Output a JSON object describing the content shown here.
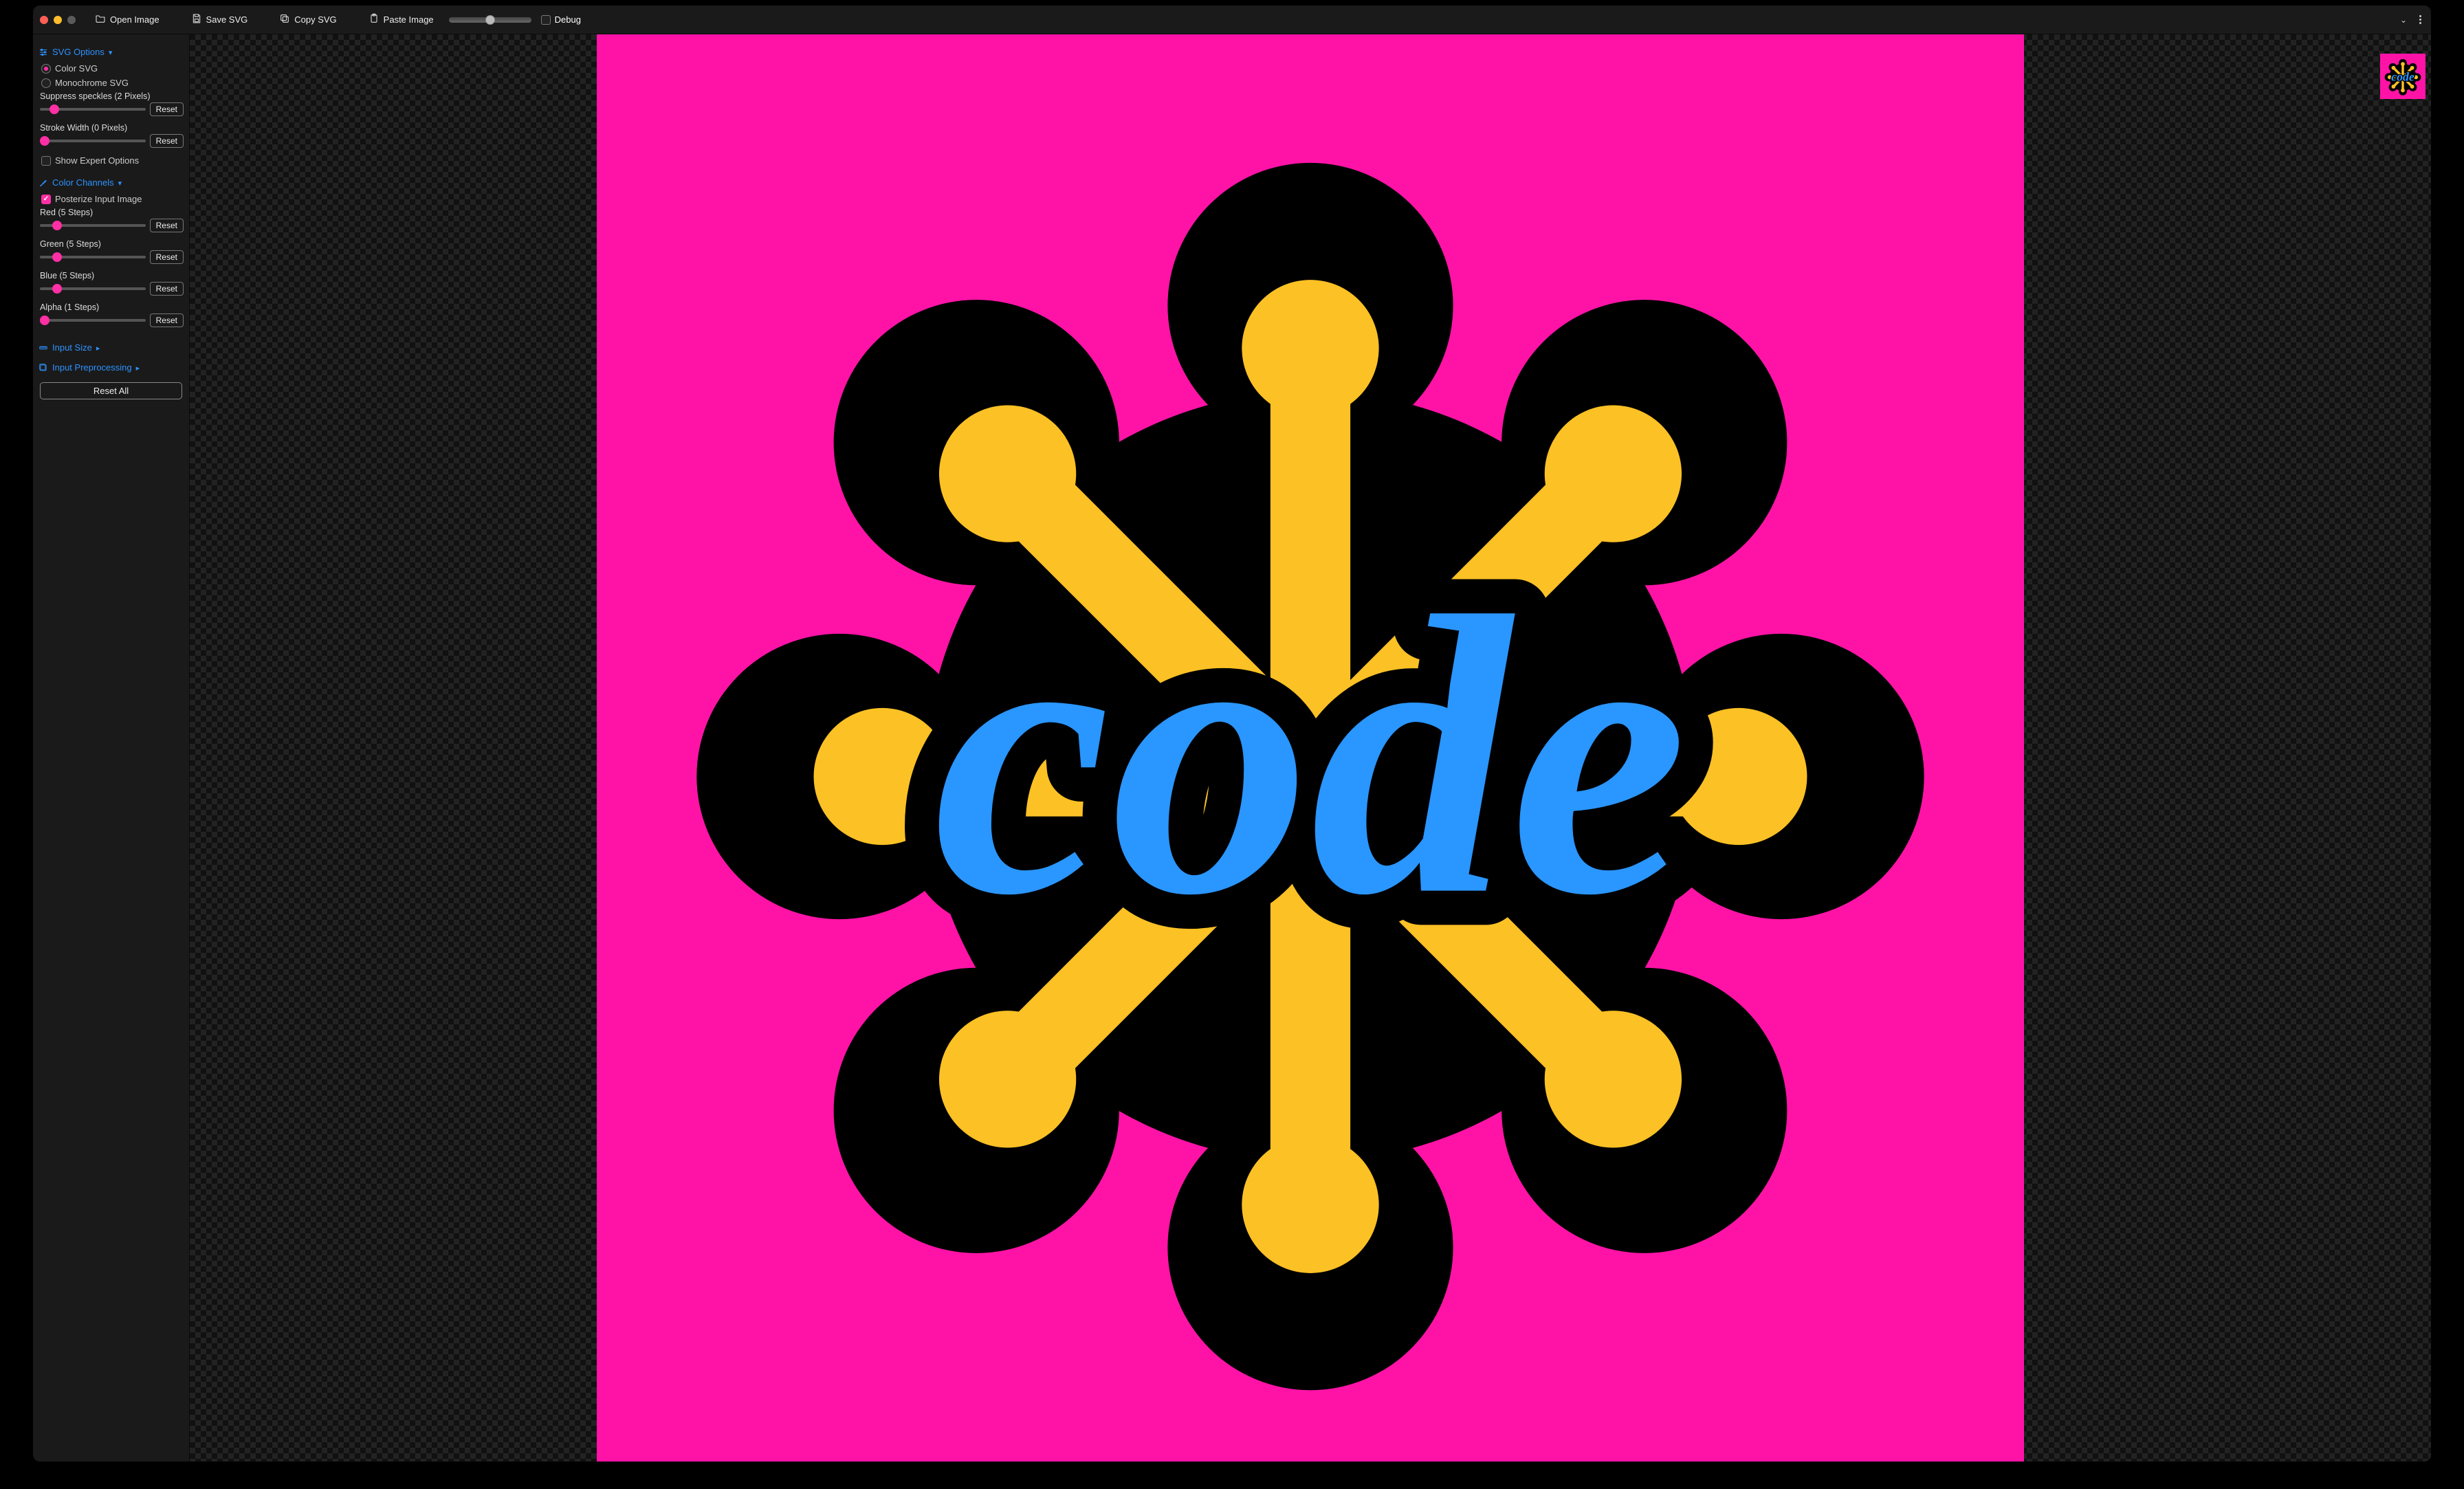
{
  "toolbar": {
    "open_label": "Open Image",
    "save_label": "Save SVG",
    "copy_label": "Copy SVG",
    "paste_label": "Paste Image",
    "debug_label": "Debug"
  },
  "sidebar": {
    "svg_options": {
      "title": "SVG Options",
      "color_svg_label": "Color SVG",
      "mono_svg_label": "Monochrome SVG",
      "speckles_label": "Suppress speckles (2 Pixels)",
      "speckles_value": 2,
      "speckles_max": 20,
      "stroke_label": "Stroke Width (0 Pixels)",
      "stroke_value": 0,
      "stroke_max": 20,
      "expert_label": "Show Expert Options",
      "reset_label": "Reset"
    },
    "color_channels": {
      "title": "Color Channels",
      "posterize_label": "Posterize Input Image",
      "red_label": "Red (5 Steps)",
      "red_value": 5,
      "red_max": 32,
      "green_label": "Green (5 Steps)",
      "green_value": 5,
      "green_max": 32,
      "blue_label": "Blue (5 Steps)",
      "blue_value": 5,
      "blue_max": 32,
      "alpha_label": "Alpha (1 Steps)",
      "alpha_value": 1,
      "alpha_max": 32,
      "reset_label": "Reset"
    },
    "input_size": {
      "title": "Input Size"
    },
    "input_preproc": {
      "title": "Input Preprocessing"
    },
    "reset_all_label": "Reset All"
  },
  "artwork": {
    "bg_color": "#ff13a7",
    "asterisk_color": "#fcc125",
    "outline_color": "#000000",
    "text_color": "#2a96ff",
    "text_value": "code"
  }
}
